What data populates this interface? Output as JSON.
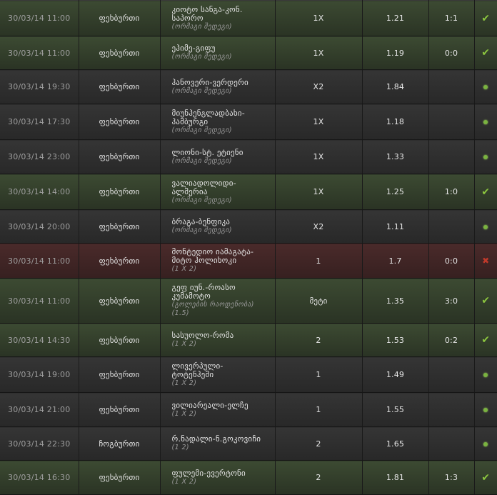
{
  "rows": [
    {
      "date": "30/03/14 11:00",
      "sport": "ფეხბურთი",
      "teams": "კიოტო სანგა-კონ.\nსაპორო",
      "market": "(ორმაგი შედეგი)",
      "pick": "1X",
      "odds": "1.21",
      "score": "1:1",
      "status": "won",
      "icon": "check-icon"
    },
    {
      "date": "30/03/14 11:00",
      "sport": "ფეხბურთი",
      "teams": "ეჰიმე-გიფუ",
      "market": "(ორმაგი შედეგი)",
      "pick": "1X",
      "odds": "1.19",
      "score": "0:0",
      "status": "won",
      "icon": "check-icon"
    },
    {
      "date": "30/03/14 19:30",
      "sport": "ფეხბურთი",
      "teams": "ჰანოვერი-ვერდერი",
      "market": "(ორმაგი შედეგი)",
      "pick": "X2",
      "odds": "1.84",
      "score": "",
      "status": "pending",
      "icon": "pending-dot-icon"
    },
    {
      "date": "30/03/14 17:30",
      "sport": "ფეხბურთი",
      "teams": "მიუნჰენგლადბახი-\nჰამბურგი",
      "market": "(ორმაგი შედეგი)",
      "pick": "1X",
      "odds": "1.18",
      "score": "",
      "status": "pending",
      "icon": "pending-dot-icon"
    },
    {
      "date": "30/03/14 23:00",
      "sport": "ფეხბურთი",
      "teams": "ლიონი-სტ. ეტიენი",
      "market": "(ორმაგი შედეგი)",
      "pick": "1X",
      "odds": "1.33",
      "score": "",
      "status": "pending",
      "icon": "pending-dot-icon"
    },
    {
      "date": "30/03/14 14:00",
      "sport": "ფეხბურთი",
      "teams": "ვალიადოლიდი-\nალმერია",
      "market": "(ორმაგი შედეგი)",
      "pick": "1X",
      "odds": "1.25",
      "score": "1:0",
      "status": "won",
      "icon": "check-icon"
    },
    {
      "date": "30/03/14 20:00",
      "sport": "ფეხბურთი",
      "teams": "ბრაგა-ბენფიკა",
      "market": "(ორმაგი შედეგი)",
      "pick": "X2",
      "odds": "1.11",
      "score": "",
      "status": "pending",
      "icon": "pending-dot-icon"
    },
    {
      "date": "30/03/14 11:00",
      "sport": "ფეხბურთი",
      "teams": "მონტედიო იამაგატა-\nმიტო ჰოლიხოკი",
      "market": "(1 X 2)",
      "pick": "1",
      "odds": "1.7",
      "score": "0:0",
      "status": "lost",
      "icon": "cross-icon"
    },
    {
      "date": "30/03/14 11:00",
      "sport": "ფეხბურთი",
      "teams": "გეფ იუნ.-როასო\nკუმამოტო",
      "market": "(გოლების რაოდენობა)\n(1.5)",
      "pick": "მეტი",
      "odds": "1.35",
      "score": "3:0",
      "status": "won",
      "icon": "check-icon"
    },
    {
      "date": "30/03/14 14:30",
      "sport": "ფეხბურთი",
      "teams": "სასუოლო-რომა",
      "market": "(1 X 2)",
      "pick": "2",
      "odds": "1.53",
      "score": "0:2",
      "status": "won",
      "icon": "check-icon"
    },
    {
      "date": "30/03/14 19:00",
      "sport": "ფეხბურთი",
      "teams": "ლივერპული-\nტოტენჰემი",
      "market": "(1 X 2)",
      "pick": "1",
      "odds": "1.49",
      "score": "",
      "status": "pending",
      "icon": "pending-dot-icon"
    },
    {
      "date": "30/03/14 21:00",
      "sport": "ფეხბურთი",
      "teams": "ვილიარეალი-ელჩე",
      "market": "(1 X 2)",
      "pick": "1",
      "odds": "1.55",
      "score": "",
      "status": "pending",
      "icon": "pending-dot-icon"
    },
    {
      "date": "30/03/14 22:30",
      "sport": "ჩოგბურთი",
      "teams": "რ.ნადალი-ნ.გოკოვიჩი",
      "market": "(1 2)",
      "pick": "2",
      "odds": "1.65",
      "score": "",
      "status": "pending",
      "icon": "pending-dot-icon"
    },
    {
      "date": "30/03/14 16:30",
      "sport": "ფეხბურთი",
      "teams": "ფულემი-ევერტონი",
      "market": "(1 X 2)",
      "pick": "2",
      "odds": "1.81",
      "score": "1:3",
      "status": "won",
      "icon": "check-icon"
    }
  ],
  "colors": {
    "won": "#8cc63f",
    "lost": "#c0392b",
    "pending": "#7ab340"
  }
}
